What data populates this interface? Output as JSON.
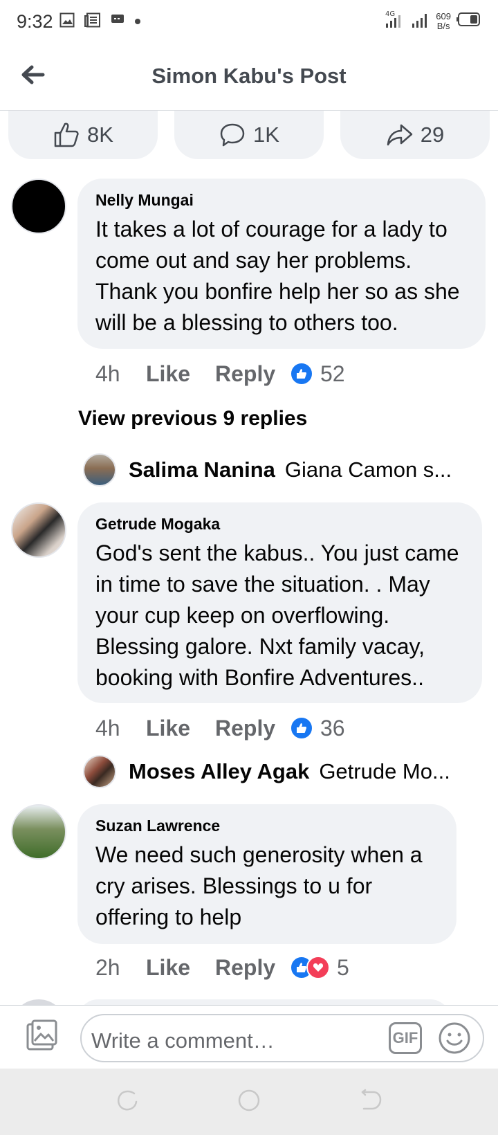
{
  "status_bar": {
    "time": "9:32",
    "net_type": "4G",
    "net_speed_value": "609",
    "net_speed_unit": "B/s"
  },
  "header": {
    "title": "Simon Kabu's Post",
    "back_icon": "arrow-left-icon"
  },
  "counts": {
    "likes": "8K",
    "comments": "1K",
    "shares": "29"
  },
  "comments": [
    {
      "author": "Nelly Mungai",
      "text": "It takes a lot of courage for a lady to come out and say her problems. Thank you bonfire help her so as she will be a blessing to others too.",
      "time": "4h",
      "like_label": "Like",
      "reply_label": "Reply",
      "reaction_count": "52"
    },
    {
      "author": "Getrude Mogaka",
      "text": "God's sent the kabus.. You just came in time to save the situation. . May your cup keep on overflowing. Blessing galore. Nxt family vacay, booking with Bonfire Adventures..",
      "time": "4h",
      "like_label": "Like",
      "reply_label": "Reply",
      "reaction_count": "36"
    },
    {
      "author": "Suzan Lawrence",
      "text": "We need such generosity when a cry arises. Blessings to u for offering to help",
      "time": "2h",
      "like_label": "Like",
      "reply_label": "Reply",
      "reaction_count": "5"
    }
  ],
  "view_previous": "View previous 9 replies",
  "replies": [
    {
      "author": "Salima Nanina",
      "preview": "Giana Camon s..."
    },
    {
      "author": "Moses Alley Agak",
      "preview": "Getrude Mo..."
    }
  ],
  "composer": {
    "placeholder": "Write a comment…",
    "gif_label": "GIF"
  },
  "colors": {
    "accent": "#1877f2",
    "love": "#f33e58",
    "bubble": "#f0f2f5",
    "secondary_text": "#65676b"
  }
}
